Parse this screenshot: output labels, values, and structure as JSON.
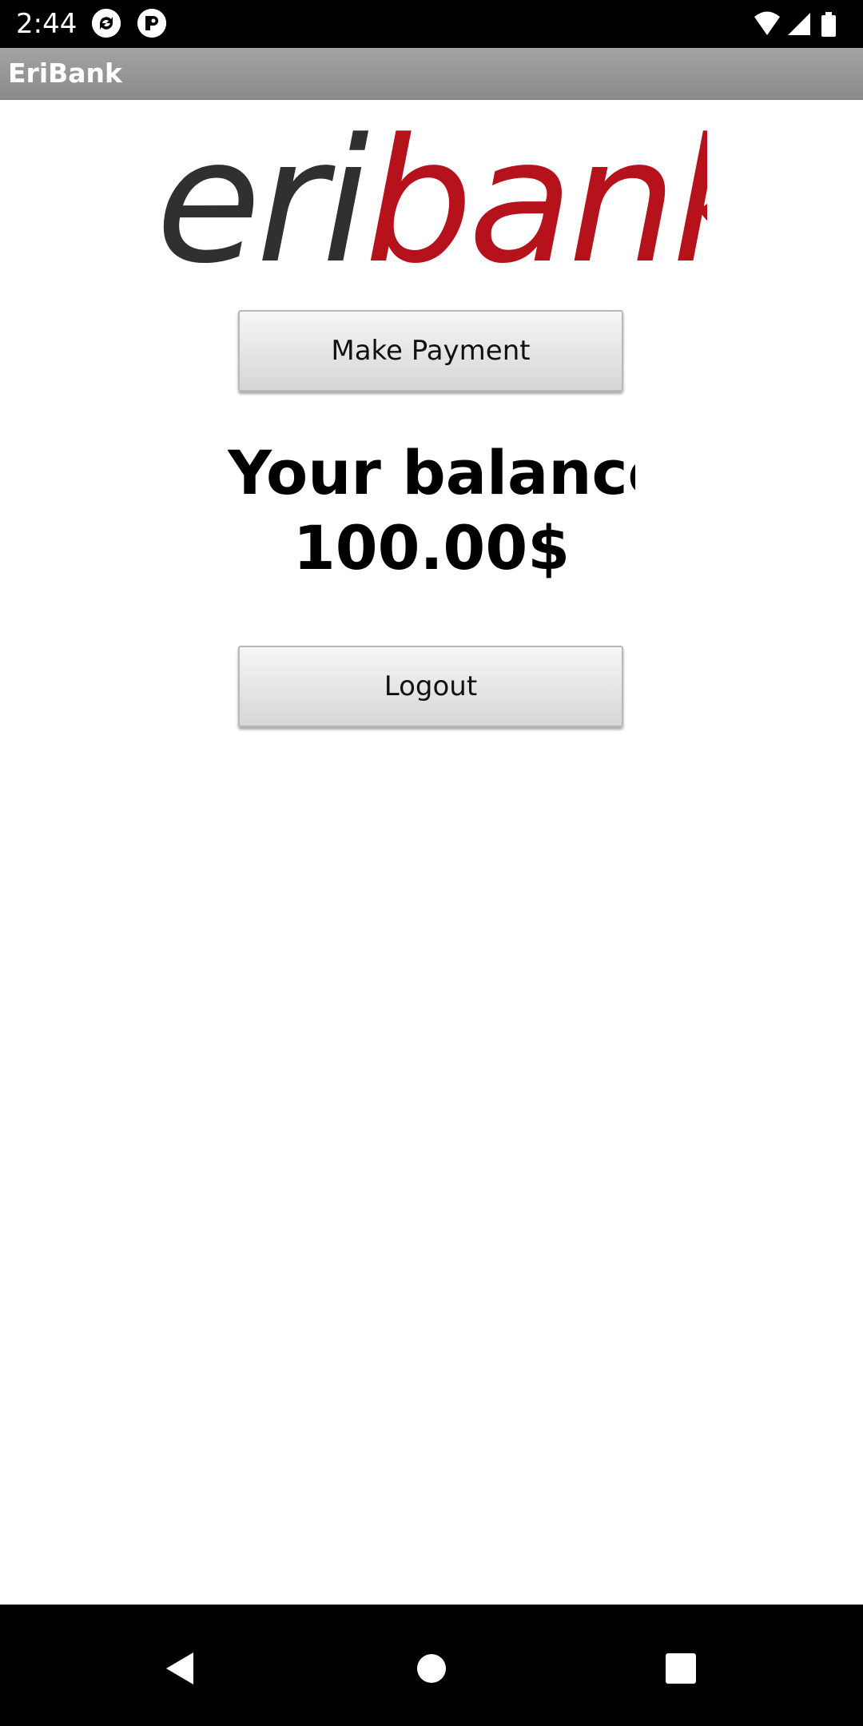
{
  "status_bar": {
    "time": "2:44",
    "icons": [
      "sync-app-icon",
      "app-notification-icon",
      "wifi-icon",
      "cellular-signal-icon",
      "battery-icon"
    ]
  },
  "toolbar": {
    "title": "EriBank"
  },
  "logo": {
    "part1": "eri",
    "part2": "bank",
    "colors": {
      "part1": "#2f3032",
      "part2": "#b5121b"
    }
  },
  "main": {
    "make_payment_label": "Make Payment",
    "balance_line1": "Your balance is",
    "balance_line2": "100.00$",
    "logout_label": "Logout"
  },
  "nav_bar": {
    "buttons": [
      "back-icon",
      "home-icon",
      "recents-icon"
    ]
  }
}
